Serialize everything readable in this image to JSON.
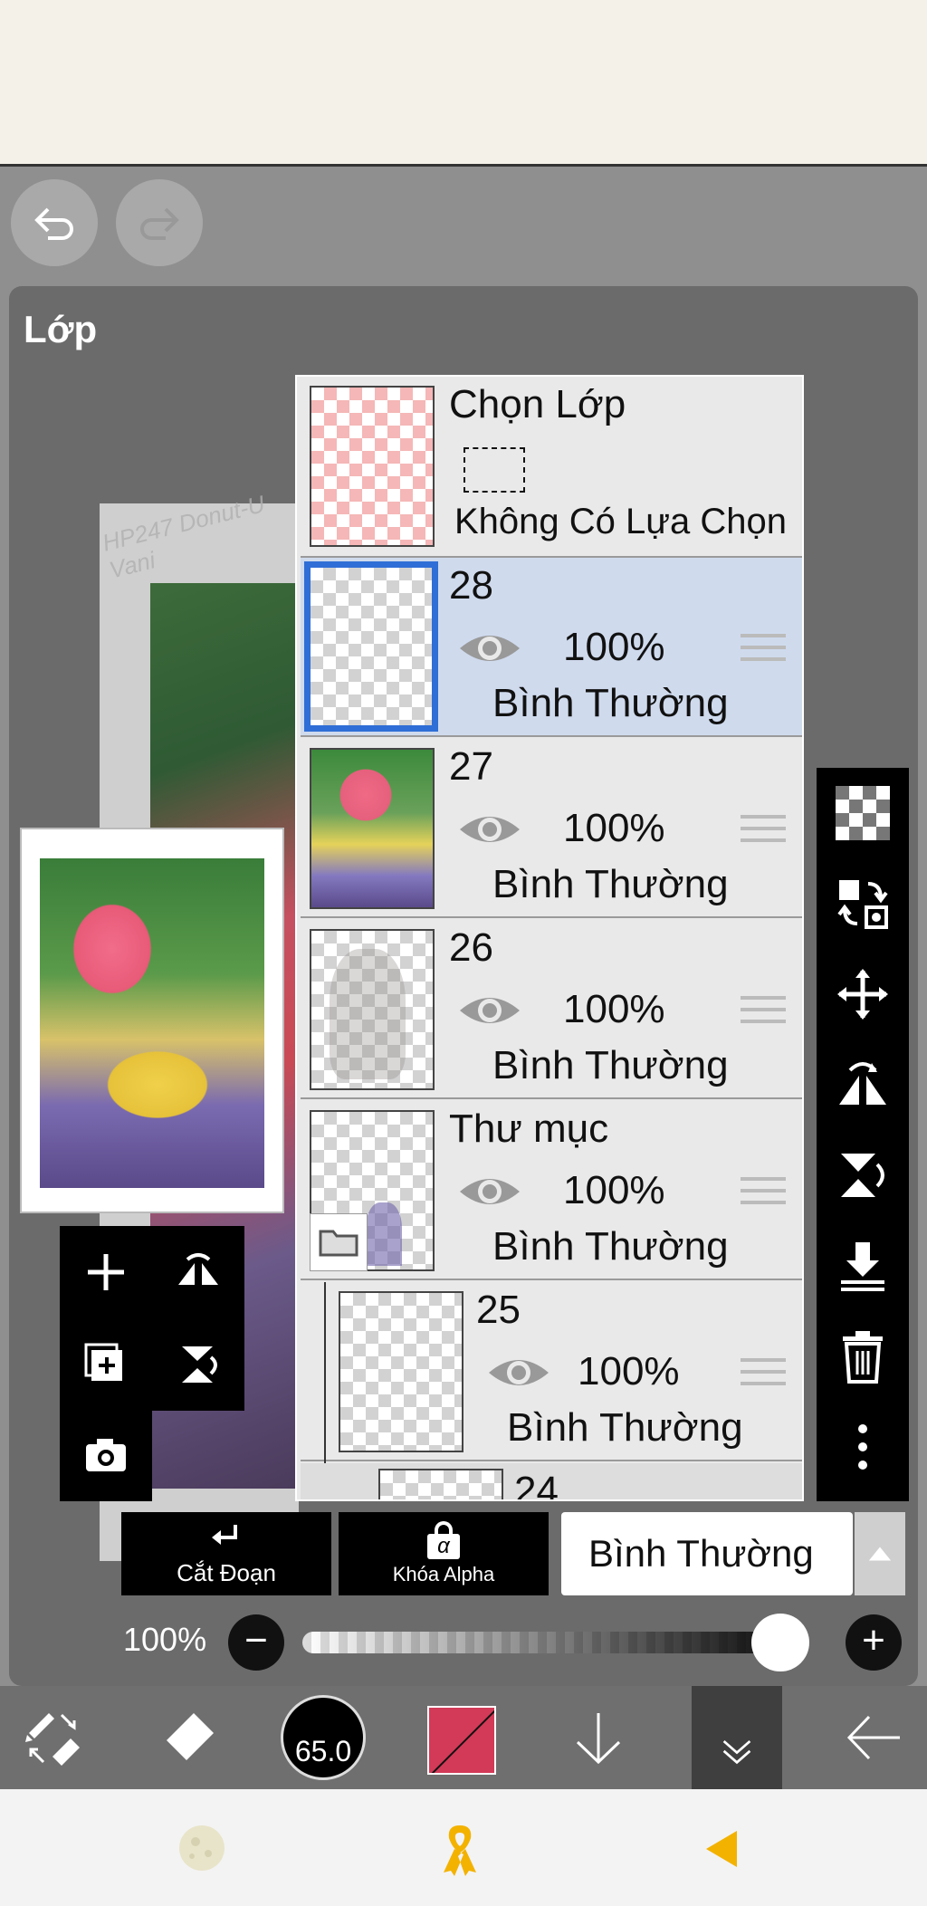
{
  "panel": {
    "title": "Lớp"
  },
  "canvas": {
    "watermark": "HP247 Donut-U Vani"
  },
  "layers": {
    "selection": {
      "name": "Chọn Lớp",
      "status": "Không Có Lựa Chọn"
    },
    "rows": [
      {
        "name": "28",
        "opacity": "100%",
        "blend": "Bình Thường",
        "selected": true
      },
      {
        "name": "27",
        "opacity": "100%",
        "blend": "Bình Thường",
        "selected": false
      },
      {
        "name": "26",
        "opacity": "100%",
        "blend": "Bình Thường",
        "selected": false
      },
      {
        "name": "Thư mục",
        "opacity": "100%",
        "blend": "Bình Thường",
        "selected": false
      },
      {
        "name": "25",
        "opacity": "100%",
        "blend": "Bình Thường",
        "selected": false
      },
      {
        "name": "24"
      }
    ]
  },
  "controls": {
    "clip_label": "Cắt Đoạn",
    "alpha_label": "Khóa Alpha",
    "alpha_glyph": "α",
    "blend_mode": "Bình Thường",
    "opacity_value": "100%",
    "opacity_fraction": 1.0,
    "minus": "−",
    "plus": "+"
  },
  "toolbar": {
    "brush_size": "65.0",
    "color": "#d23a57"
  },
  "colors": {
    "selected_row": "#cfdaed",
    "selection_frame": "#2f6ed6",
    "system_accent": "#f3b200"
  }
}
